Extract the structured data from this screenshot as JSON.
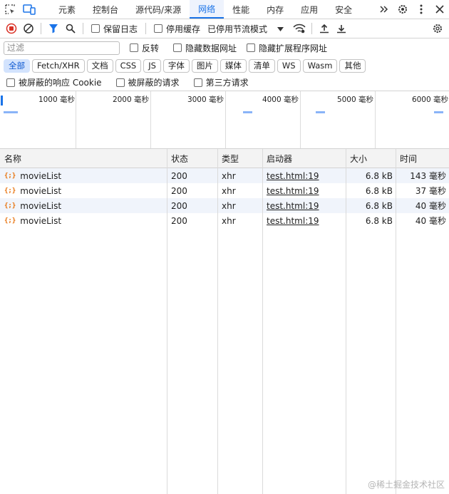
{
  "tabs": [
    {
      "label": "元素",
      "active": false
    },
    {
      "label": "控制台",
      "active": false
    },
    {
      "label": "源代码/来源",
      "active": false
    },
    {
      "label": "网络",
      "active": true
    },
    {
      "label": "性能",
      "active": false
    },
    {
      "label": "内存",
      "active": false
    },
    {
      "label": "应用",
      "active": false
    },
    {
      "label": "安全",
      "active": false
    }
  ],
  "toolbar": {
    "preserve_log": "保留日志",
    "disable_cache": "停用缓存",
    "throttling": "已停用节流模式"
  },
  "filter": {
    "placeholder": "过滤",
    "invert": "反转",
    "hide_data_urls": "隐藏数据网址",
    "hide_extension_urls": "隐藏扩展程序网址"
  },
  "type_filters": [
    "全部",
    "Fetch/XHR",
    "文档",
    "CSS",
    "JS",
    "字体",
    "图片",
    "媒体",
    "清单",
    "WS",
    "Wasm",
    "其他"
  ],
  "blocked": {
    "blocked_cookies": "被屏蔽的响应 Cookie",
    "blocked_requests": "被屏蔽的请求",
    "third_party": "第三方请求"
  },
  "overview": {
    "ticks": [
      "1000 毫秒",
      "2000 毫秒",
      "3000 毫秒",
      "4000 毫秒",
      "5000 毫秒",
      "6000 毫秒"
    ]
  },
  "table": {
    "columns": [
      "名称",
      "状态",
      "类型",
      "启动器",
      "大小",
      "时间"
    ],
    "rows": [
      {
        "name": "movieList",
        "status": "200",
        "type": "xhr",
        "initiator": "test.html:19",
        "size": "6.8 kB",
        "time": "143 毫秒"
      },
      {
        "name": "movieList",
        "status": "200",
        "type": "xhr",
        "initiator": "test.html:19",
        "size": "6.8 kB",
        "time": "37 毫秒"
      },
      {
        "name": "movieList",
        "status": "200",
        "type": "xhr",
        "initiator": "test.html:19",
        "size": "6.8 kB",
        "time": "40 毫秒"
      },
      {
        "name": "movieList",
        "status": "200",
        "type": "xhr",
        "initiator": "test.html:19",
        "size": "6.8 kB",
        "time": "40 毫秒"
      }
    ]
  },
  "watermark": "@稀土掘金技术社区",
  "colors": {
    "accent": "#1a73e8",
    "record": "#d93025",
    "xhr_icon": "#e8710a"
  }
}
